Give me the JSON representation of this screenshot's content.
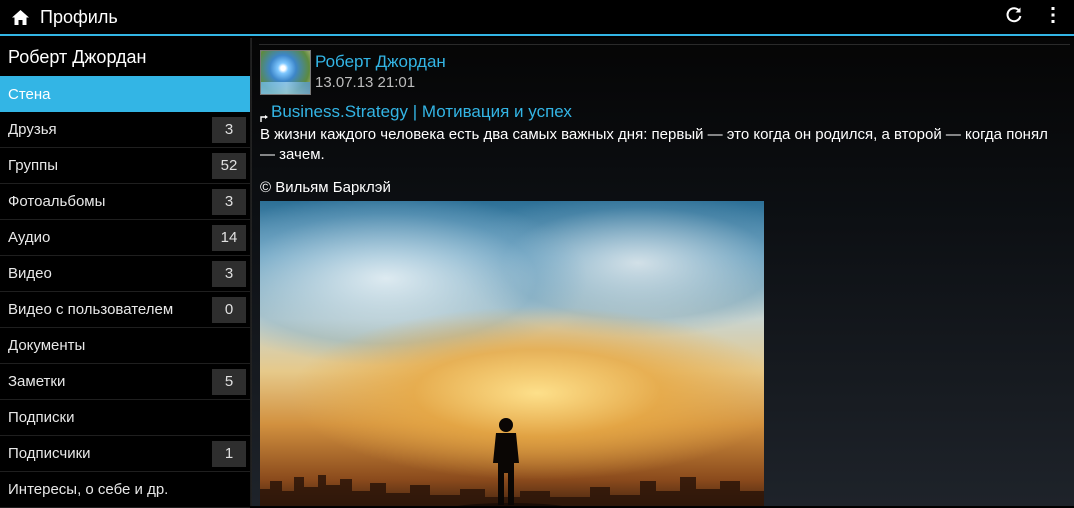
{
  "actionbar": {
    "title": "Профиль",
    "home_icon": "home-icon",
    "refresh_icon": "refresh-icon",
    "overflow_icon": "overflow-menu-icon",
    "accent": "#33b5e5"
  },
  "sidebar": {
    "header": "Роберт Джордан",
    "items": [
      {
        "label": "Стена",
        "count": null,
        "active": true
      },
      {
        "label": "Друзья",
        "count": "3"
      },
      {
        "label": "Группы",
        "count": "52"
      },
      {
        "label": "Фотоальбомы",
        "count": "3"
      },
      {
        "label": "Аудио",
        "count": "14"
      },
      {
        "label": "Видео",
        "count": "3"
      },
      {
        "label": "Видео с пользователем",
        "count": "0"
      },
      {
        "label": "Документы",
        "count": null
      },
      {
        "label": "Заметки",
        "count": "5"
      },
      {
        "label": "Подписки",
        "count": null
      },
      {
        "label": "Подписчики",
        "count": "1"
      },
      {
        "label": "Интересы, о себе и др.",
        "count": null
      }
    ]
  },
  "post": {
    "author": "Роберт Джордан",
    "date": "13.07.13 21:01",
    "repost_source": "Business.Strategy | Мотивация и успех",
    "text": "В жизни каждого человека есть два самых важных дня: первый — это когда он родился, а второй — когда понял — зачем.",
    "quote": "© Вильям Барклэй"
  },
  "colors": {
    "link": "#33b5e5",
    "active_item": "#33b5e5",
    "badge_bg": "#2e2e2e"
  }
}
